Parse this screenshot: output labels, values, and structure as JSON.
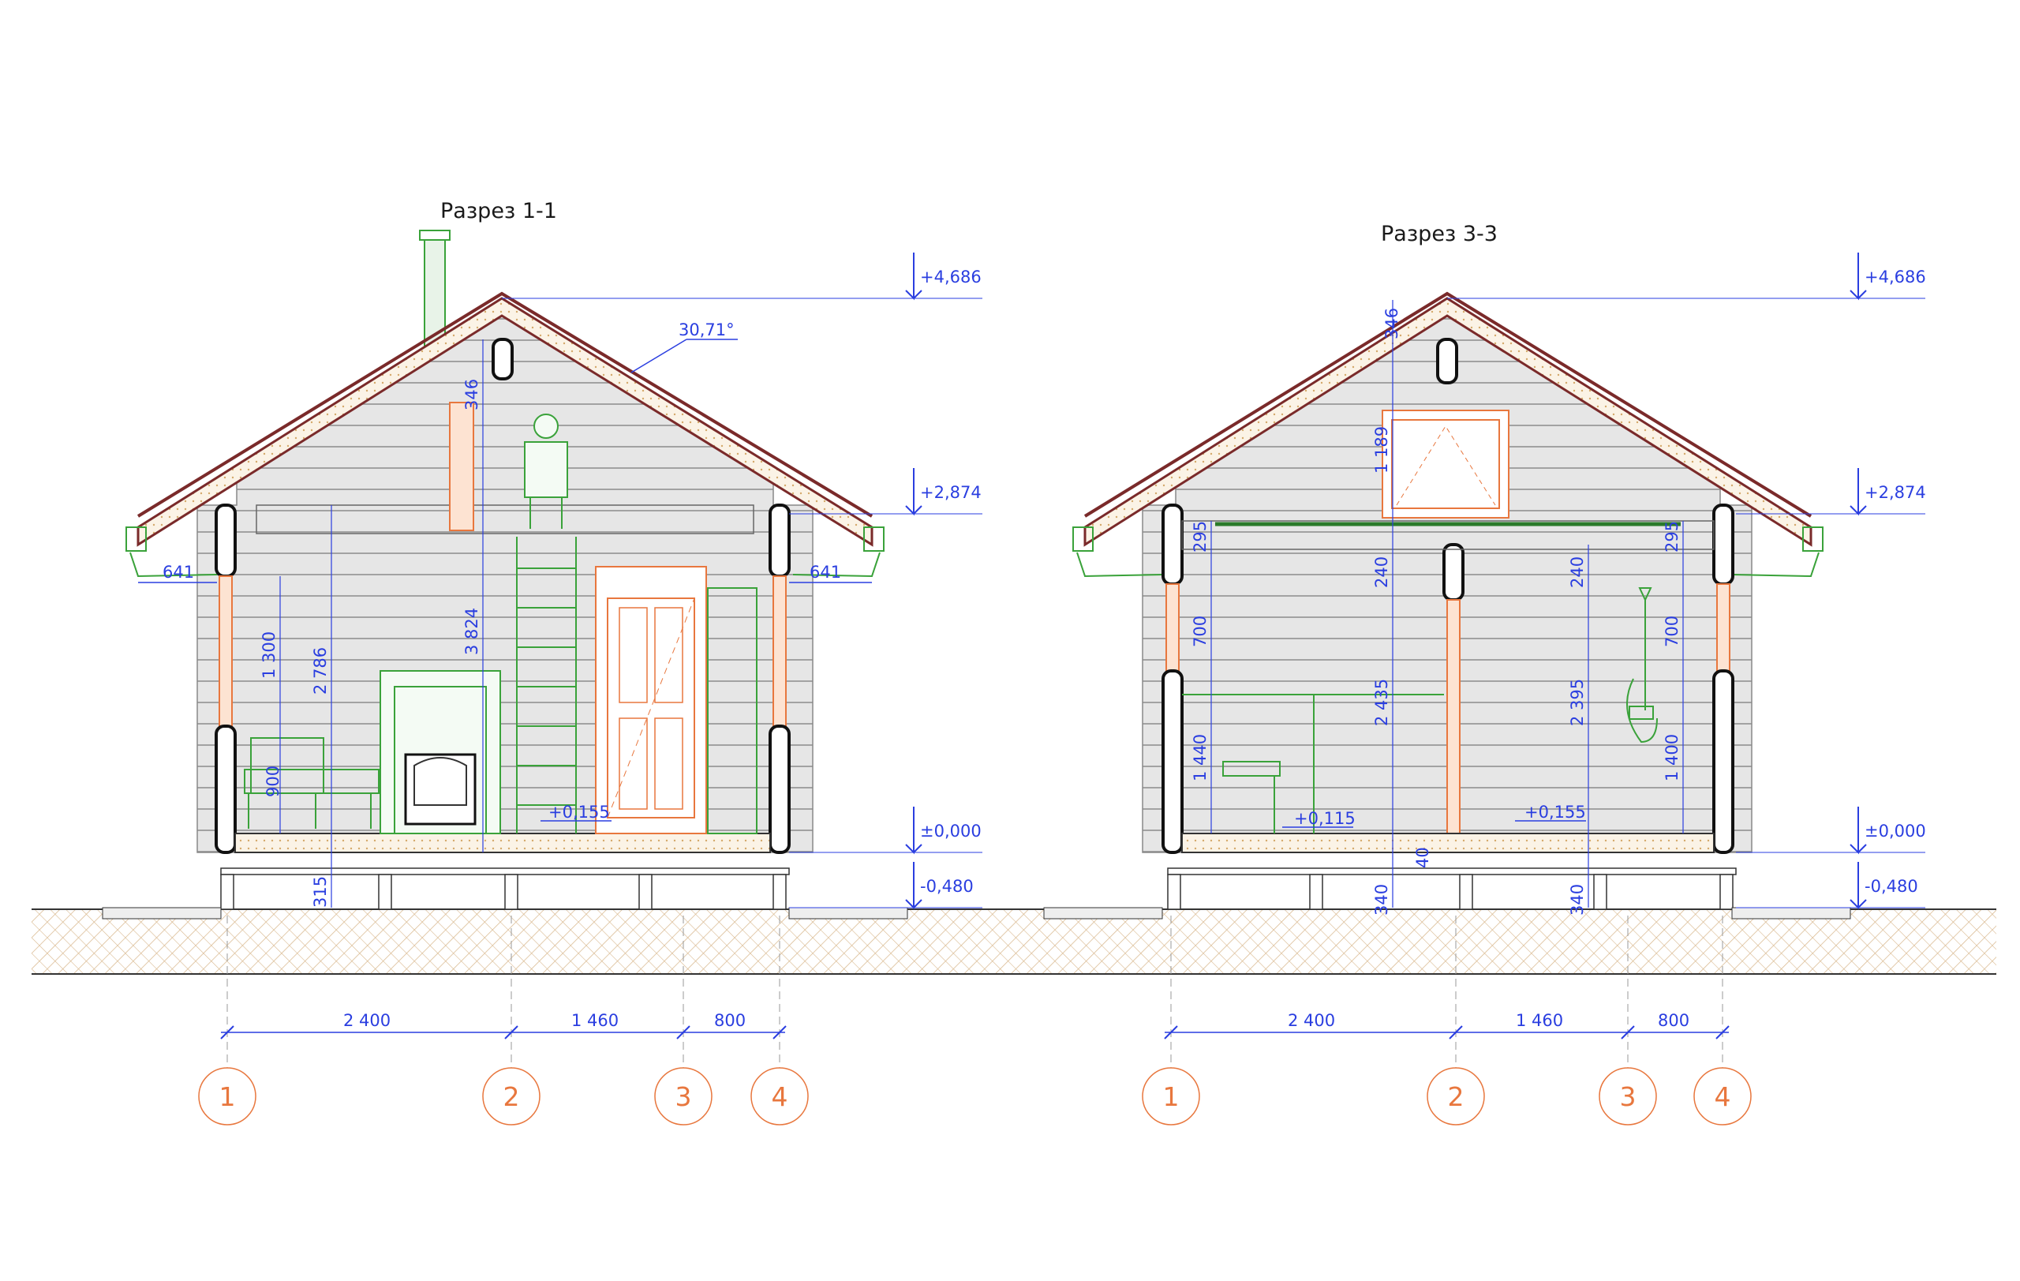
{
  "sections": [
    {
      "title": "Разрез 1-1",
      "angle": "30,71°",
      "levels": [
        "+4,686",
        "+2,874",
        "±0,000",
        "-0,480"
      ],
      "floor_mark": "+0,155",
      "eave_left": "641",
      "eave_right": "641",
      "dims": [
        "346",
        "1 300",
        "2 786",
        "3 824",
        "900",
        "315"
      ],
      "axis_dims": [
        "2 400",
        "1 460",
        "800"
      ],
      "axes": [
        "1",
        "2",
        "3",
        "4"
      ]
    },
    {
      "title": "Разрез 3-3",
      "levels": [
        "+4,686",
        "+2,874",
        "±0,000",
        "-0,480"
      ],
      "floor_marks": [
        "+0,115",
        "+0,155"
      ],
      "dims": [
        "346",
        "1 189",
        "295",
        "700",
        "1 440",
        "240",
        "2 435",
        "40",
        "340",
        "240",
        "2 395",
        "295",
        "700",
        "1 400",
        "340"
      ],
      "axis_dims": [
        "2 400",
        "1 460",
        "800"
      ],
      "axes": [
        "1",
        "2",
        "3",
        "4"
      ]
    }
  ],
  "colors": {
    "dimension": "#2a3ee0",
    "axis": "#e8773e",
    "wood": "#e8773e",
    "furniture": "#3aa23a",
    "roof": "#7a2a2a",
    "line": "#333333"
  }
}
